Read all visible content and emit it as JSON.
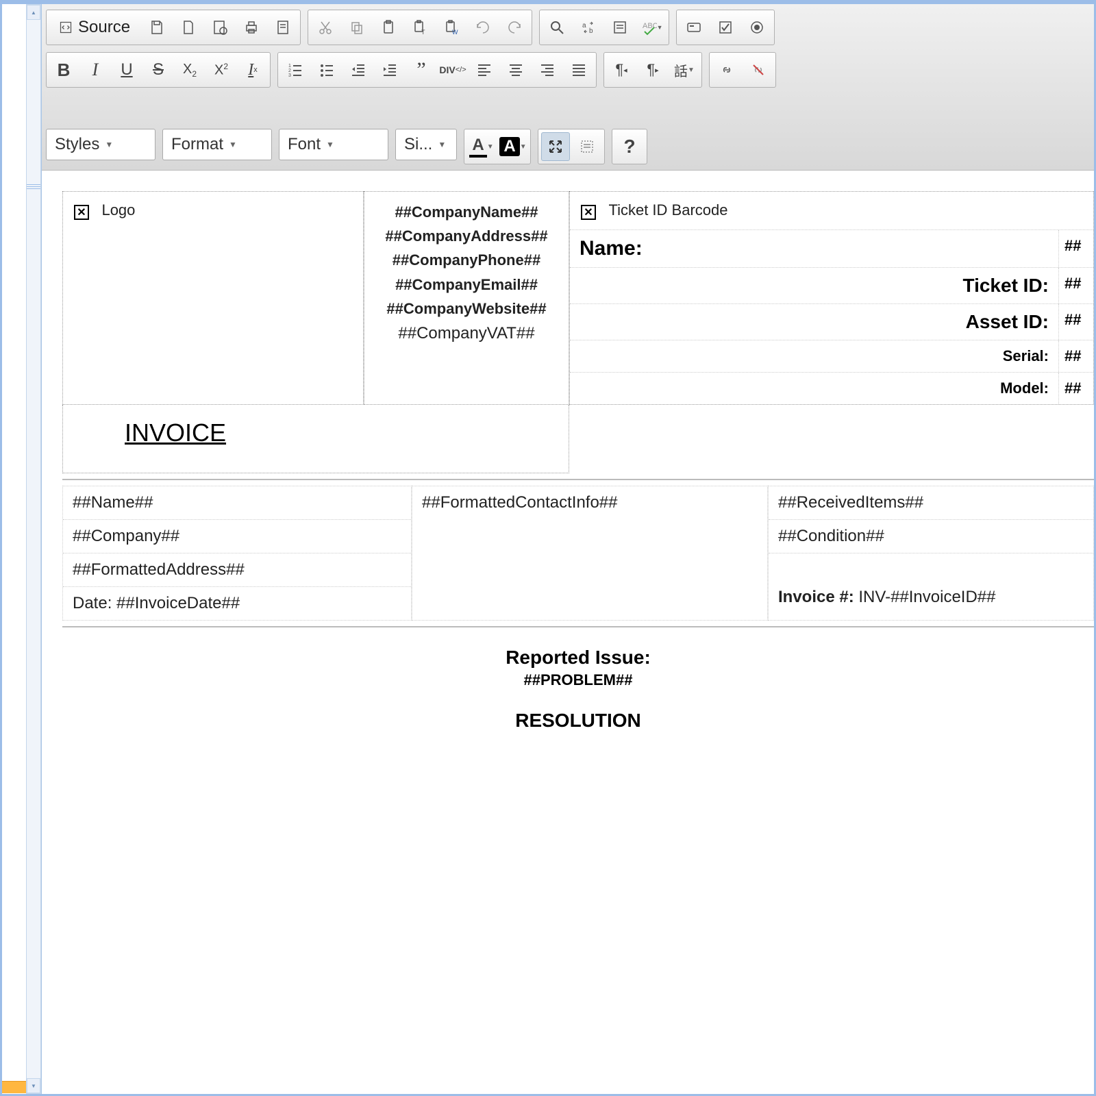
{
  "toolbar": {
    "source": "Source",
    "styles": "Styles",
    "format": "Format",
    "font": "Font",
    "size": "Si..."
  },
  "template": {
    "logo_label": "Logo",
    "barcode_label": "Ticket ID Barcode",
    "company": {
      "name": "##CompanyName##",
      "address": "##CompanyAddress##",
      "phone": "##CompanyPhone##",
      "email": "##CompanyEmail##",
      "website": "##CompanyWebsite##",
      "vat": "##CompanyVAT##"
    },
    "info_rows": [
      {
        "label": "Name:",
        "value": "##"
      },
      {
        "label": "Ticket ID:",
        "value": "##"
      },
      {
        "label": "Asset ID:",
        "value": "##"
      },
      {
        "label": "Serial:",
        "value": "##"
      },
      {
        "label": "Model:",
        "value": "##"
      }
    ],
    "invoice_heading": "INVOICE",
    "contact": {
      "name": "##Name##",
      "company": "##Company##",
      "address": "##FormattedAddress##",
      "date_label": "Date:",
      "date_value": "##InvoiceDate##",
      "contact_info": "##FormattedContactInfo##",
      "received": "##ReceivedItems##",
      "condition": "##Condition##",
      "invoice_num_label": "Invoice #:",
      "invoice_num_value": "INV-##InvoiceID##"
    },
    "issue": {
      "title": "Reported Issue:",
      "value": "##PROBLEM##",
      "resolution": "RESOLUTION"
    }
  }
}
